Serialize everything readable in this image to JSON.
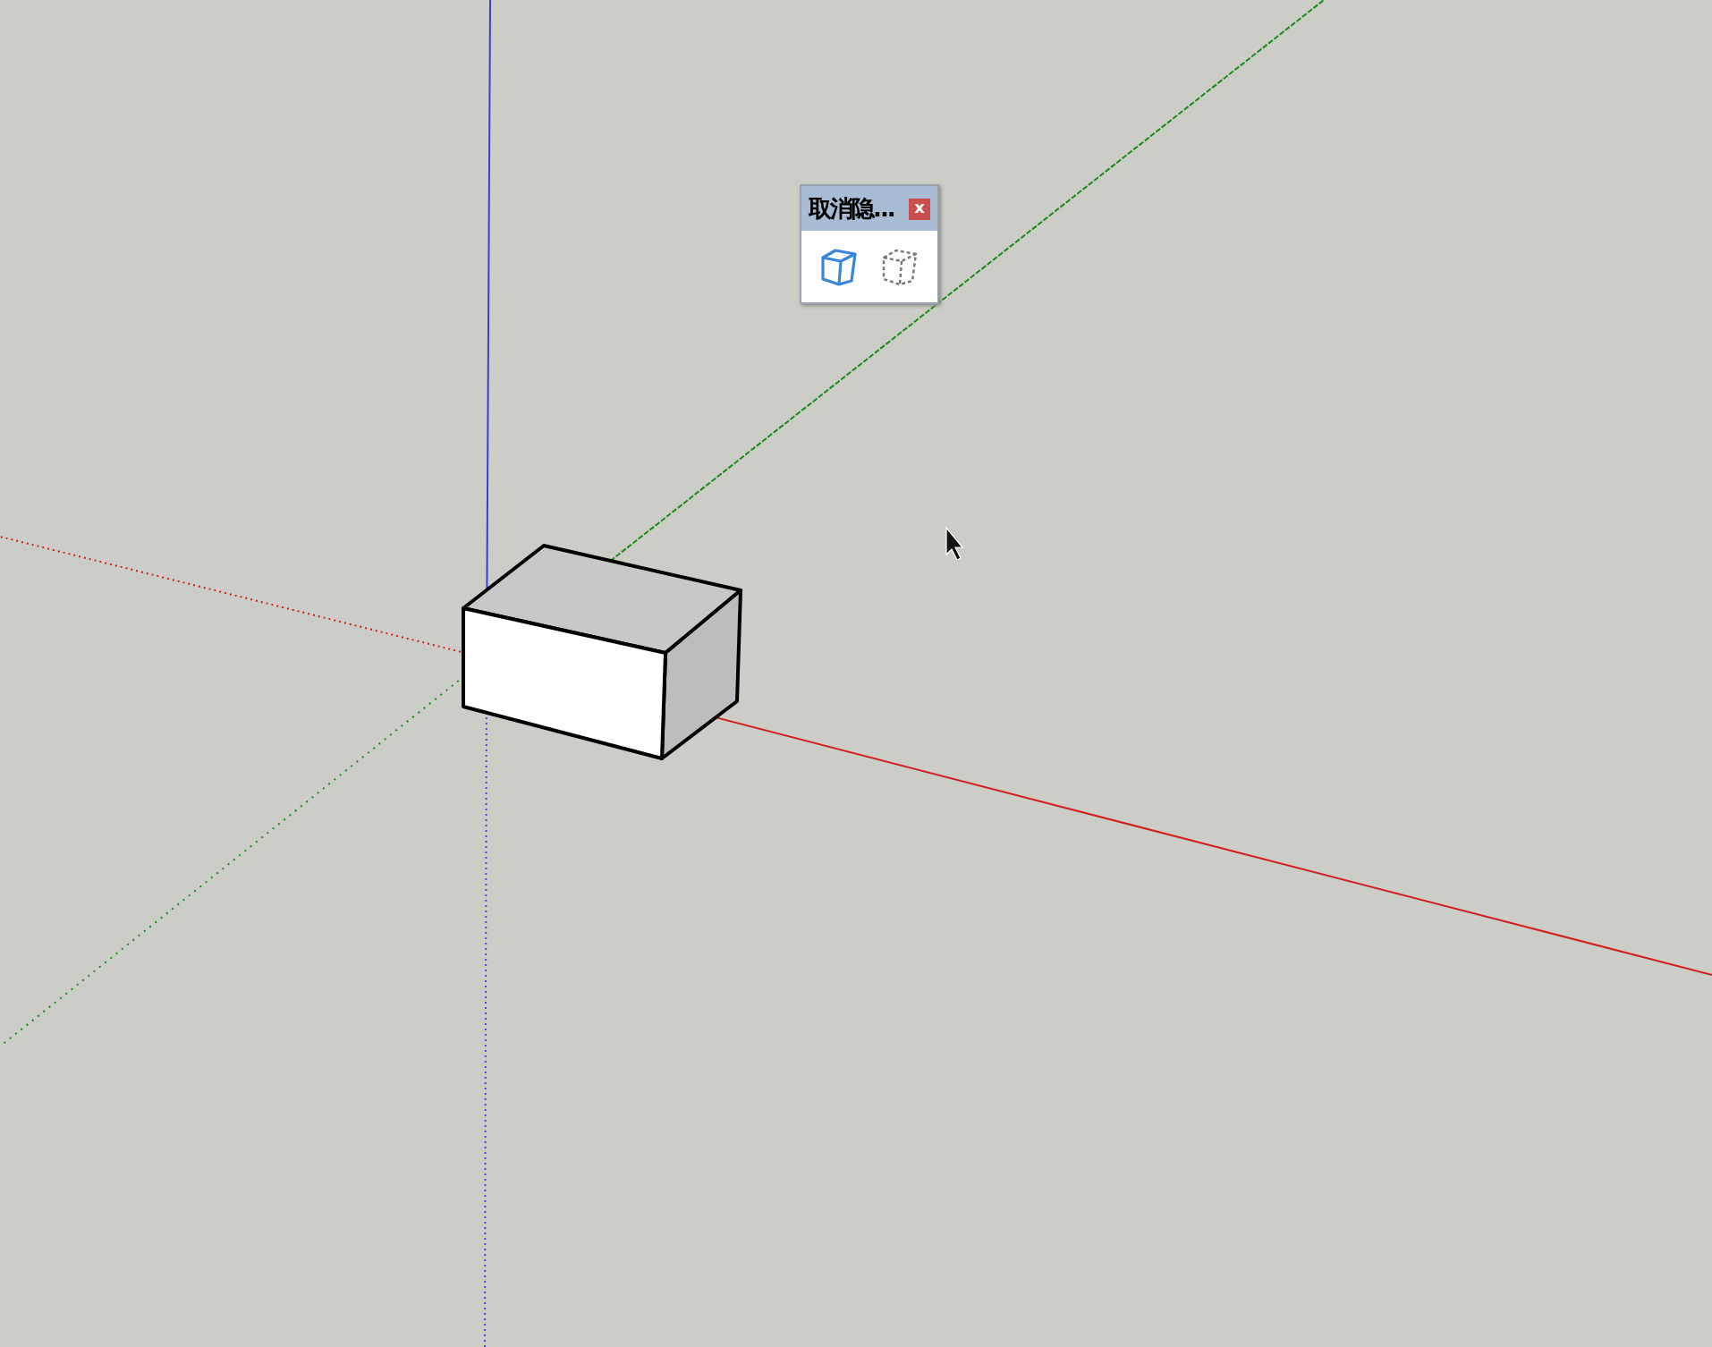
{
  "toolbar": {
    "title": "取消隐...",
    "close": "x"
  }
}
